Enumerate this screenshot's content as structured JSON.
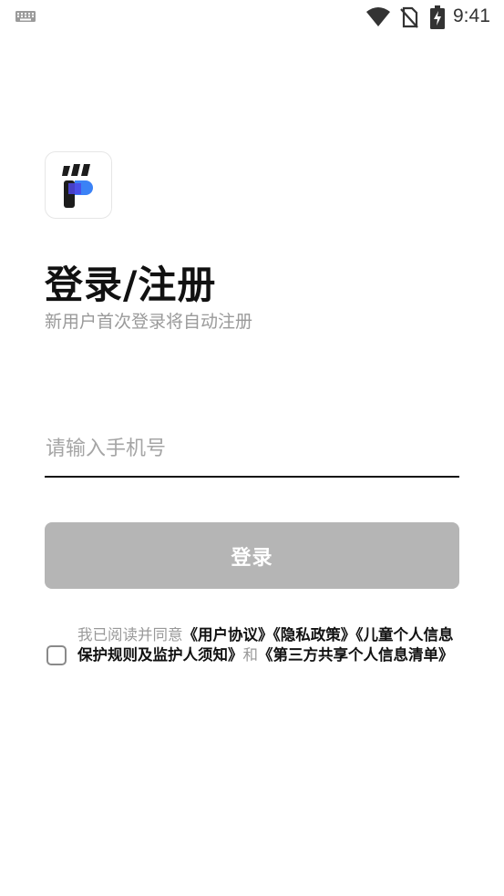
{
  "status_bar": {
    "time": "9:41",
    "icons": [
      "keyboard-icon",
      "wifi-icon",
      "no-sim-icon",
      "battery-charging-icon"
    ]
  },
  "app": {
    "logo_icon": "app-logo-icon",
    "title": "登录/注册",
    "subtitle": "新用户首次登录将自动注册"
  },
  "phone_input": {
    "placeholder": "请输入手机号",
    "value": ""
  },
  "login_button": {
    "label": "登录",
    "color": "#b5b5b5"
  },
  "agreement": {
    "checked": false,
    "prefix": "我已阅读并同意",
    "user_agreement": "《用户协议》",
    "privacy_policy": "《隐私政策》",
    "children_rules": "《儿童个人信息保护规则及监护人须知》",
    "and": "和",
    "third_party_list": "《第三方共享个人信息清单》"
  }
}
